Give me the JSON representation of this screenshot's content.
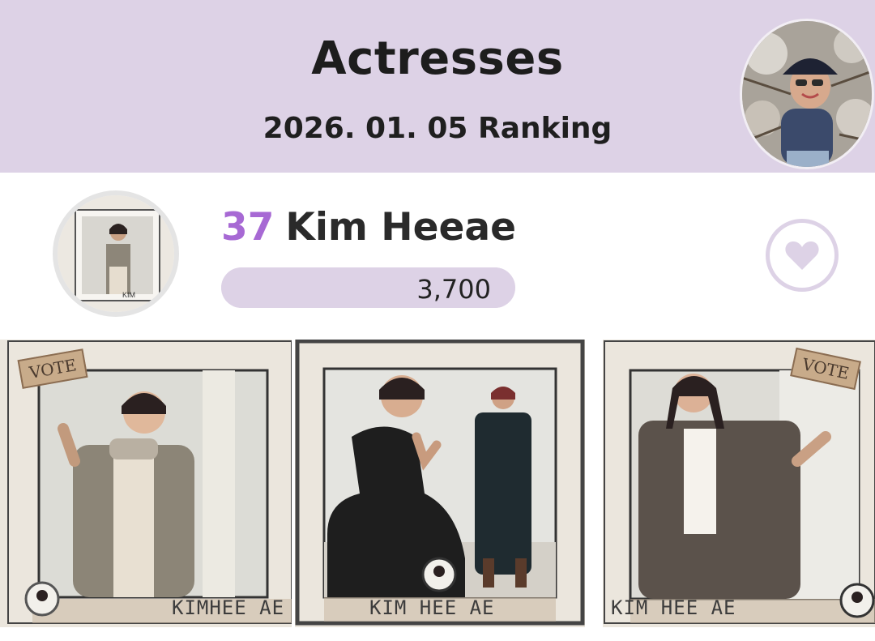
{
  "header": {
    "title": "Actresses",
    "subtitle": "2026. 01. 05 Ranking",
    "avatar_icon": "user-profile-avatar"
  },
  "entry": {
    "rank": "37",
    "name": "Kim Heeae",
    "votes": "3,700",
    "vote_progress": 1.0,
    "like_icon": "heart-icon",
    "avatar_label": "KIM"
  },
  "gallery": {
    "photos": [
      {
        "tag": "VOTE",
        "caption": "KIMHEE AE"
      },
      {
        "tag": "",
        "caption": "KIM HEE AE"
      },
      {
        "tag": "VOTE",
        "caption": "KIM HEE AE"
      }
    ]
  },
  "colors": {
    "header_bg": "#ddd2e6",
    "accent": "#a769d4",
    "text": "#1d1d1d"
  }
}
